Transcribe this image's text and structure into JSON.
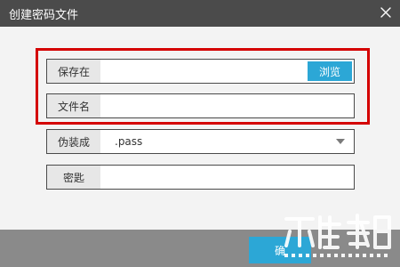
{
  "window": {
    "title": "创建密码文件"
  },
  "form": {
    "save_label": "保存在",
    "save_value": "",
    "browse_label": "浏览",
    "filename_label": "文件名",
    "filename_value": "",
    "disguise_label": "伪装成",
    "disguise_value": ".pass",
    "key_label": "密匙",
    "key_value": ""
  },
  "footer": {
    "confirm_label": "确"
  },
  "colors": {
    "titlebar": "#4b4b4b",
    "accent": "#2ca7d6",
    "highlight": "#d40000",
    "background": "#f3f3f3",
    "bottom_bar": "#8a8a8a"
  },
  "icons": {
    "close": "close-icon",
    "dropdown": "chevron-down-icon"
  }
}
